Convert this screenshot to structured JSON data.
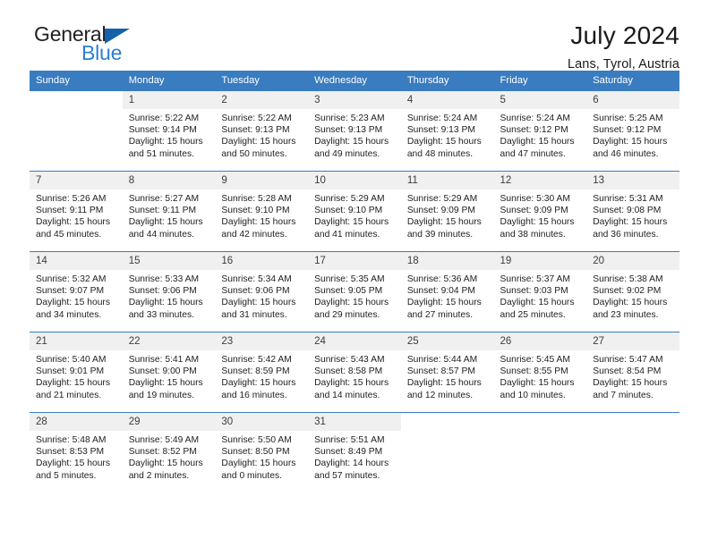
{
  "logo": {
    "word1": "General",
    "word2": "Blue",
    "triangle_color": "#1462ab",
    "word2_color": "#2980d4"
  },
  "header": {
    "title": "July 2024",
    "subtitle": "Lans, Tyrol, Austria"
  },
  "calendar": {
    "header_bg": "#3a7cc0",
    "daynum_bg": "#f0f0f0",
    "weekdays": [
      "Sunday",
      "Monday",
      "Tuesday",
      "Wednesday",
      "Thursday",
      "Friday",
      "Saturday"
    ],
    "weeks": [
      [
        {
          "day": "",
          "sunrise": "",
          "sunset": "",
          "daylight1": "",
          "daylight2": ""
        },
        {
          "day": "1",
          "sunrise": "Sunrise: 5:22 AM",
          "sunset": "Sunset: 9:14 PM",
          "daylight1": "Daylight: 15 hours",
          "daylight2": "and 51 minutes."
        },
        {
          "day": "2",
          "sunrise": "Sunrise: 5:22 AM",
          "sunset": "Sunset: 9:13 PM",
          "daylight1": "Daylight: 15 hours",
          "daylight2": "and 50 minutes."
        },
        {
          "day": "3",
          "sunrise": "Sunrise: 5:23 AM",
          "sunset": "Sunset: 9:13 PM",
          "daylight1": "Daylight: 15 hours",
          "daylight2": "and 49 minutes."
        },
        {
          "day": "4",
          "sunrise": "Sunrise: 5:24 AM",
          "sunset": "Sunset: 9:13 PM",
          "daylight1": "Daylight: 15 hours",
          "daylight2": "and 48 minutes."
        },
        {
          "day": "5",
          "sunrise": "Sunrise: 5:24 AM",
          "sunset": "Sunset: 9:12 PM",
          "daylight1": "Daylight: 15 hours",
          "daylight2": "and 47 minutes."
        },
        {
          "day": "6",
          "sunrise": "Sunrise: 5:25 AM",
          "sunset": "Sunset: 9:12 PM",
          "daylight1": "Daylight: 15 hours",
          "daylight2": "and 46 minutes."
        }
      ],
      [
        {
          "day": "7",
          "sunrise": "Sunrise: 5:26 AM",
          "sunset": "Sunset: 9:11 PM",
          "daylight1": "Daylight: 15 hours",
          "daylight2": "and 45 minutes."
        },
        {
          "day": "8",
          "sunrise": "Sunrise: 5:27 AM",
          "sunset": "Sunset: 9:11 PM",
          "daylight1": "Daylight: 15 hours",
          "daylight2": "and 44 minutes."
        },
        {
          "day": "9",
          "sunrise": "Sunrise: 5:28 AM",
          "sunset": "Sunset: 9:10 PM",
          "daylight1": "Daylight: 15 hours",
          "daylight2": "and 42 minutes."
        },
        {
          "day": "10",
          "sunrise": "Sunrise: 5:29 AM",
          "sunset": "Sunset: 9:10 PM",
          "daylight1": "Daylight: 15 hours",
          "daylight2": "and 41 minutes."
        },
        {
          "day": "11",
          "sunrise": "Sunrise: 5:29 AM",
          "sunset": "Sunset: 9:09 PM",
          "daylight1": "Daylight: 15 hours",
          "daylight2": "and 39 minutes."
        },
        {
          "day": "12",
          "sunrise": "Sunrise: 5:30 AM",
          "sunset": "Sunset: 9:09 PM",
          "daylight1": "Daylight: 15 hours",
          "daylight2": "and 38 minutes."
        },
        {
          "day": "13",
          "sunrise": "Sunrise: 5:31 AM",
          "sunset": "Sunset: 9:08 PM",
          "daylight1": "Daylight: 15 hours",
          "daylight2": "and 36 minutes."
        }
      ],
      [
        {
          "day": "14",
          "sunrise": "Sunrise: 5:32 AM",
          "sunset": "Sunset: 9:07 PM",
          "daylight1": "Daylight: 15 hours",
          "daylight2": "and 34 minutes."
        },
        {
          "day": "15",
          "sunrise": "Sunrise: 5:33 AM",
          "sunset": "Sunset: 9:06 PM",
          "daylight1": "Daylight: 15 hours",
          "daylight2": "and 33 minutes."
        },
        {
          "day": "16",
          "sunrise": "Sunrise: 5:34 AM",
          "sunset": "Sunset: 9:06 PM",
          "daylight1": "Daylight: 15 hours",
          "daylight2": "and 31 minutes."
        },
        {
          "day": "17",
          "sunrise": "Sunrise: 5:35 AM",
          "sunset": "Sunset: 9:05 PM",
          "daylight1": "Daylight: 15 hours",
          "daylight2": "and 29 minutes."
        },
        {
          "day": "18",
          "sunrise": "Sunrise: 5:36 AM",
          "sunset": "Sunset: 9:04 PM",
          "daylight1": "Daylight: 15 hours",
          "daylight2": "and 27 minutes."
        },
        {
          "day": "19",
          "sunrise": "Sunrise: 5:37 AM",
          "sunset": "Sunset: 9:03 PM",
          "daylight1": "Daylight: 15 hours",
          "daylight2": "and 25 minutes."
        },
        {
          "day": "20",
          "sunrise": "Sunrise: 5:38 AM",
          "sunset": "Sunset: 9:02 PM",
          "daylight1": "Daylight: 15 hours",
          "daylight2": "and 23 minutes."
        }
      ],
      [
        {
          "day": "21",
          "sunrise": "Sunrise: 5:40 AM",
          "sunset": "Sunset: 9:01 PM",
          "daylight1": "Daylight: 15 hours",
          "daylight2": "and 21 minutes."
        },
        {
          "day": "22",
          "sunrise": "Sunrise: 5:41 AM",
          "sunset": "Sunset: 9:00 PM",
          "daylight1": "Daylight: 15 hours",
          "daylight2": "and 19 minutes."
        },
        {
          "day": "23",
          "sunrise": "Sunrise: 5:42 AM",
          "sunset": "Sunset: 8:59 PM",
          "daylight1": "Daylight: 15 hours",
          "daylight2": "and 16 minutes."
        },
        {
          "day": "24",
          "sunrise": "Sunrise: 5:43 AM",
          "sunset": "Sunset: 8:58 PM",
          "daylight1": "Daylight: 15 hours",
          "daylight2": "and 14 minutes."
        },
        {
          "day": "25",
          "sunrise": "Sunrise: 5:44 AM",
          "sunset": "Sunset: 8:57 PM",
          "daylight1": "Daylight: 15 hours",
          "daylight2": "and 12 minutes."
        },
        {
          "day": "26",
          "sunrise": "Sunrise: 5:45 AM",
          "sunset": "Sunset: 8:55 PM",
          "daylight1": "Daylight: 15 hours",
          "daylight2": "and 10 minutes."
        },
        {
          "day": "27",
          "sunrise": "Sunrise: 5:47 AM",
          "sunset": "Sunset: 8:54 PM",
          "daylight1": "Daylight: 15 hours",
          "daylight2": "and 7 minutes."
        }
      ],
      [
        {
          "day": "28",
          "sunrise": "Sunrise: 5:48 AM",
          "sunset": "Sunset: 8:53 PM",
          "daylight1": "Daylight: 15 hours",
          "daylight2": "and 5 minutes."
        },
        {
          "day": "29",
          "sunrise": "Sunrise: 5:49 AM",
          "sunset": "Sunset: 8:52 PM",
          "daylight1": "Daylight: 15 hours",
          "daylight2": "and 2 minutes."
        },
        {
          "day": "30",
          "sunrise": "Sunrise: 5:50 AM",
          "sunset": "Sunset: 8:50 PM",
          "daylight1": "Daylight: 15 hours",
          "daylight2": "and 0 minutes."
        },
        {
          "day": "31",
          "sunrise": "Sunrise: 5:51 AM",
          "sunset": "Sunset: 8:49 PM",
          "daylight1": "Daylight: 14 hours",
          "daylight2": "and 57 minutes."
        },
        {
          "day": "",
          "sunrise": "",
          "sunset": "",
          "daylight1": "",
          "daylight2": ""
        },
        {
          "day": "",
          "sunrise": "",
          "sunset": "",
          "daylight1": "",
          "daylight2": ""
        },
        {
          "day": "",
          "sunrise": "",
          "sunset": "",
          "daylight1": "",
          "daylight2": ""
        }
      ]
    ]
  }
}
